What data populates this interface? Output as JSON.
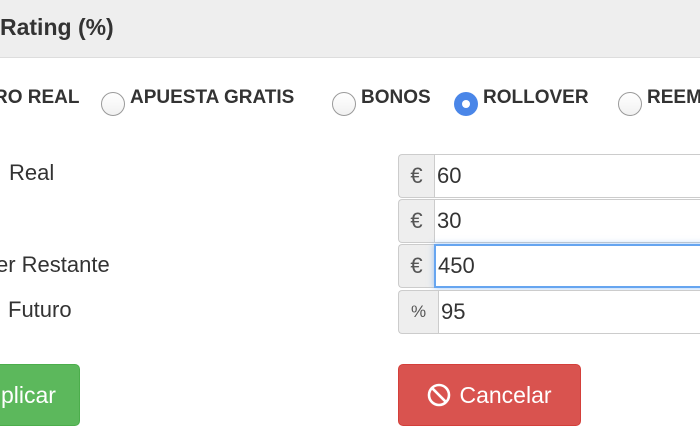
{
  "header": {
    "title": "Rating (%)"
  },
  "bet_types": [
    {
      "label": "RO REAL",
      "checked": false
    },
    {
      "label": "APUESTA GRATIS",
      "checked": false
    },
    {
      "label": "BONOS",
      "checked": false
    },
    {
      "label": "ROLLOVER",
      "checked": true
    },
    {
      "label": "REEM",
      "checked": false
    }
  ],
  "fields": [
    {
      "label": "Real",
      "addon": "€",
      "value": "60"
    },
    {
      "label": "",
      "addon": "€",
      "value": "30"
    },
    {
      "label": "er Restante",
      "addon": "€",
      "value": "450"
    },
    {
      "label": "Futuro",
      "addon": "%",
      "value": "95"
    }
  ],
  "buttons": {
    "apply_label": "plicar",
    "cancel_label": "Cancelar"
  },
  "colors": {
    "apply": "#5cb85c",
    "cancel": "#d9534f",
    "radio_checked": "#4a86e8",
    "focus": "#66a5f0"
  }
}
